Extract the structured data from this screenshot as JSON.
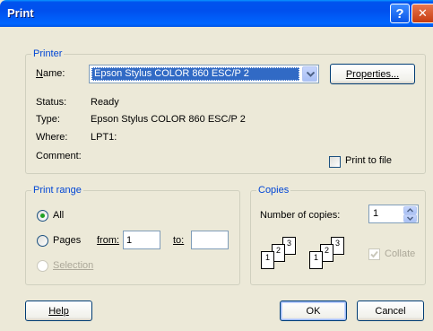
{
  "window": {
    "title": "Print",
    "help_glyph": "?",
    "close_glyph": "✕"
  },
  "printer": {
    "group_label": "Printer",
    "name_label": "Name:",
    "name_value": "Epson Stylus COLOR 860 ESC/P 2",
    "properties_label": "Properties...",
    "status_label": "Status:",
    "status_value": "Ready",
    "type_label": "Type:",
    "type_value": "Epson Stylus COLOR 860 ESC/P 2",
    "where_label": "Where:",
    "where_value": "LPT1:",
    "comment_label": "Comment:",
    "comment_value": "",
    "print_to_file_label": "Print to file",
    "print_to_file_checked": false
  },
  "print_range": {
    "group_label": "Print range",
    "all_label": "All",
    "pages_label": "Pages",
    "from_label": "from:",
    "from_value": "1",
    "to_label": "to:",
    "to_value": "",
    "selection_label": "Selection",
    "selected": "all"
  },
  "copies": {
    "group_label": "Copies",
    "number_label": "Number of copies:",
    "number_value": "1",
    "collate_label": "Collate",
    "collate_checked": true,
    "collate_enabled": false,
    "stack_pages": [
      "1",
      "2",
      "3"
    ]
  },
  "footer": {
    "help_label": "Help",
    "ok_label": "OK",
    "cancel_label": "Cancel"
  },
  "colors": {
    "titlebar": "#0054e3",
    "dialog_bg": "#ece9d8",
    "group_label": "#0046d5",
    "selection_bg": "#316ac5"
  },
  "icons": [
    "help-icon",
    "close-icon",
    "dropdown-arrow-icon",
    "spin-up-icon",
    "spin-down-icon",
    "collate-stack-icon",
    "checkmark-icon"
  ]
}
